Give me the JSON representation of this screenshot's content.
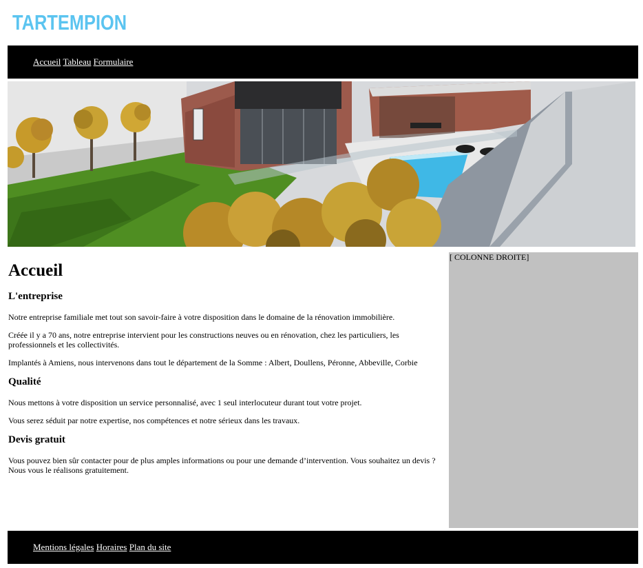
{
  "brand": {
    "name": "TARTEMPION",
    "logo_icon": "van-icon",
    "color": "#5bc4f0"
  },
  "nav": {
    "items": [
      "Accueil",
      "Tableau",
      "Formulaire"
    ]
  },
  "hero": {
    "icon": "house-pool-render-image"
  },
  "main": {
    "title": "Accueil",
    "sections": [
      {
        "heading": "L'entreprise",
        "paragraphs": [
          "Notre entreprise familiale met tout son savoir-faire à votre disposition dans le domaine de la rénovation immobilière.",
          "Créée il y a 70 ans, notre entreprise intervient pour les constructions neuves ou en rénovation, chez les particuliers, les professionnels et les collectivités.",
          "Implantés à Amiens, nous intervenons dans tout le département de la Somme : Albert, Doullens, Péronne, Abbeville, Corbie"
        ]
      },
      {
        "heading": "Qualité",
        "paragraphs": [
          "Nous mettons à votre disposition un service personnalisé, avec 1 seul interlocuteur durant tout votre projet.",
          "Vous serez séduit par notre expertise, nos compétences et notre sérieux dans les travaux."
        ]
      },
      {
        "heading": "Devis gratuit",
        "paragraphs": [
          "Vous pouvez bien sûr contacter pour de plus amples informations ou pour une demande d’intervention. Vous souhaitez un devis ? Nous vous le réalisons gratuitement."
        ]
      }
    ]
  },
  "right_column": {
    "label": "[ COLONNE DROITE]",
    "color": "#c1c1c1"
  },
  "footer": {
    "items": [
      "Mentions légales",
      "Horaires",
      "Plan du site"
    ]
  }
}
